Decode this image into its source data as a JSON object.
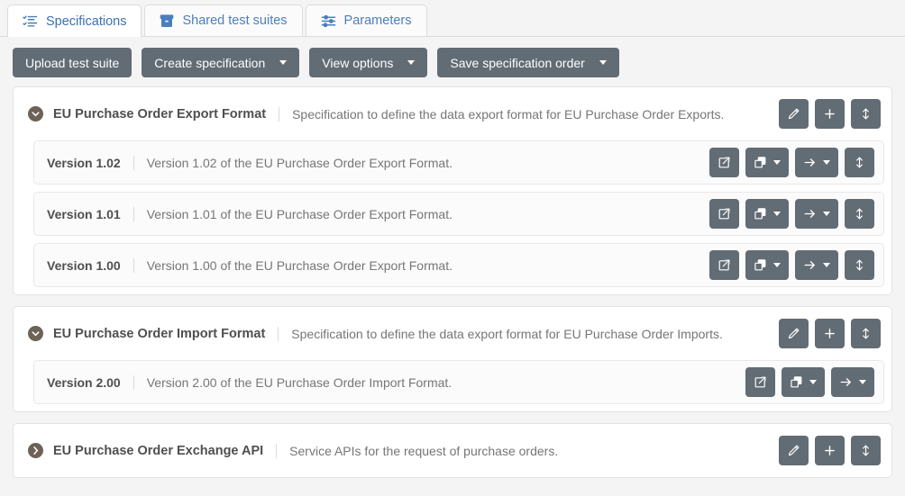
{
  "tabs": [
    {
      "id": "specifications",
      "label": "Specifications",
      "icon": "task-list-icon",
      "active": true
    },
    {
      "id": "shared-test-suites",
      "label": "Shared test suites",
      "icon": "archive-icon",
      "active": false
    },
    {
      "id": "parameters",
      "label": "Parameters",
      "icon": "sliders-icon",
      "active": false
    }
  ],
  "toolbar": [
    {
      "id": "upload-test-suite",
      "label": "Upload test suite",
      "caret": false
    },
    {
      "id": "create-specification",
      "label": "Create specification",
      "caret": true
    },
    {
      "id": "view-options",
      "label": "View options",
      "caret": true
    },
    {
      "id": "save-specification-order",
      "label": "Save specification order",
      "caret": true
    }
  ],
  "specifications": [
    {
      "id": "eu-purchase-order-export-format",
      "title": "EU Purchase Order Export Format",
      "description": "Specification to define the data export format for EU Purchase Order Exports.",
      "expanded": true,
      "toggle_icon": "chevron-down-circle-icon",
      "actions": [
        {
          "id": "edit",
          "icon": "pencil-icon",
          "caret": false
        },
        {
          "id": "add",
          "icon": "plus-icon",
          "caret": false
        },
        {
          "id": "reorder",
          "icon": "arrows-updown-icon",
          "caret": false
        }
      ],
      "versions": [
        {
          "id": "version-1-02",
          "name": "Version 1.02",
          "description": "Version 1.02 of the EU Purchase Order Export Format.",
          "actions": [
            {
              "id": "open",
              "icon": "external-link-icon",
              "caret": false
            },
            {
              "id": "copy",
              "icon": "copy-icon",
              "caret": true
            },
            {
              "id": "move",
              "icon": "arrow-right-icon",
              "caret": true
            },
            {
              "id": "reorder",
              "icon": "arrows-updown-icon",
              "caret": false
            }
          ]
        },
        {
          "id": "version-1-01",
          "name": "Version 1.01",
          "description": "Version 1.01 of the EU Purchase Order Export Format.",
          "actions": [
            {
              "id": "open",
              "icon": "external-link-icon",
              "caret": false
            },
            {
              "id": "copy",
              "icon": "copy-icon",
              "caret": true
            },
            {
              "id": "move",
              "icon": "arrow-right-icon",
              "caret": true
            },
            {
              "id": "reorder",
              "icon": "arrows-updown-icon",
              "caret": false
            }
          ]
        },
        {
          "id": "version-1-00",
          "name": "Version 1.00",
          "description": "Version 1.00 of the EU Purchase Order Export Format.",
          "actions": [
            {
              "id": "open",
              "icon": "external-link-icon",
              "caret": false
            },
            {
              "id": "copy",
              "icon": "copy-icon",
              "caret": true
            },
            {
              "id": "move",
              "icon": "arrow-right-icon",
              "caret": true
            },
            {
              "id": "reorder",
              "icon": "arrows-updown-icon",
              "caret": false
            }
          ]
        }
      ]
    },
    {
      "id": "eu-purchase-order-import-format",
      "title": "EU Purchase Order Import Format",
      "description": "Specification to define the data export format for EU Purchase Order Imports.",
      "expanded": true,
      "toggle_icon": "chevron-down-circle-icon",
      "actions": [
        {
          "id": "edit",
          "icon": "pencil-icon",
          "caret": false
        },
        {
          "id": "add",
          "icon": "plus-icon",
          "caret": false
        },
        {
          "id": "reorder",
          "icon": "arrows-updown-icon",
          "caret": false
        }
      ],
      "versions": [
        {
          "id": "version-2-00",
          "name": "Version 2.00",
          "description": "Version 2.00 of the EU Purchase Order Import Format.",
          "actions": [
            {
              "id": "open",
              "icon": "external-link-icon",
              "caret": false
            },
            {
              "id": "copy",
              "icon": "copy-icon",
              "caret": true
            },
            {
              "id": "move",
              "icon": "arrow-right-icon",
              "caret": true
            }
          ]
        }
      ]
    },
    {
      "id": "eu-purchase-order-exchange-api",
      "title": "EU Purchase Order Exchange API",
      "description": "Service APIs for the request of purchase orders.",
      "expanded": false,
      "toggle_icon": "chevron-right-circle-icon",
      "actions": [
        {
          "id": "edit",
          "icon": "pencil-icon",
          "caret": false
        },
        {
          "id": "add",
          "icon": "plus-icon",
          "caret": false
        },
        {
          "id": "reorder",
          "icon": "arrows-updown-icon",
          "caret": false
        }
      ],
      "versions": []
    }
  ],
  "colors": {
    "button": "#626c75",
    "tab_text": "#3d6fb0",
    "toggle_circle": "#6d6257",
    "page_background": "#f4f4f4",
    "card_background": "#ffffff",
    "version_background": "#fbfbfb"
  }
}
